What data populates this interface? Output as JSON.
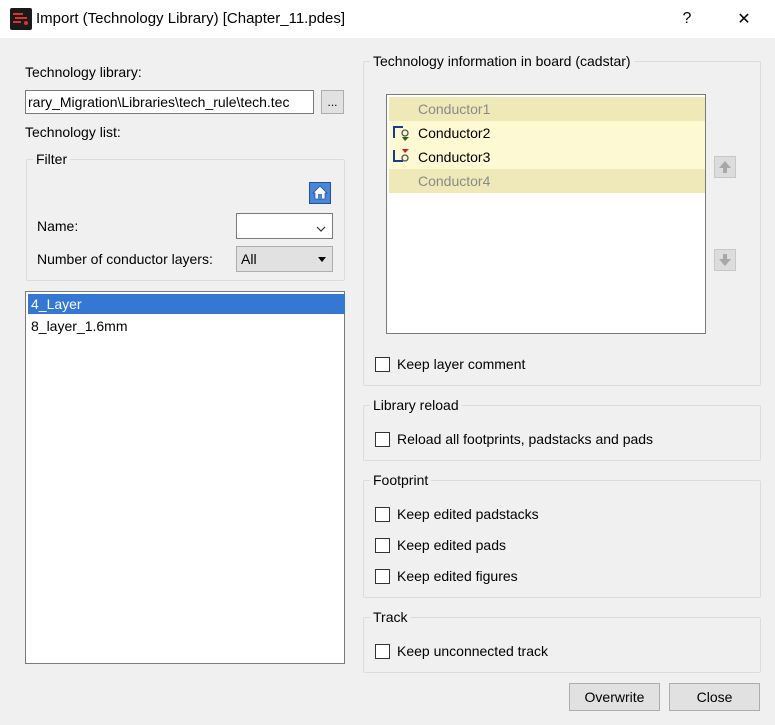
{
  "window": {
    "title": "Import (Technology Library) [Chapter_11.pdes]",
    "help_label": "?",
    "close_label": "✕"
  },
  "left": {
    "tech_library_label": "Technology library:",
    "tech_library_value": "rary_Migration\\Libraries\\tech_rule\\tech.tec",
    "browse_label": "...",
    "tech_list_label": "Technology list:",
    "filter": {
      "legend": "Filter",
      "name_label": "Name:",
      "name_value": "",
      "layers_label": "Number of conductor layers:",
      "layers_value": "All"
    },
    "list": {
      "items": [
        "4_Layer",
        "8_layer_1.6mm"
      ],
      "selected_index": 0
    }
  },
  "right": {
    "tech_info": {
      "legend": "Technology information in board (cadstar)",
      "conductors": [
        {
          "label": "Conductor1",
          "enabled": false
        },
        {
          "label": "Conductor2",
          "enabled": true
        },
        {
          "label": "Conductor3",
          "enabled": true
        },
        {
          "label": "Conductor4",
          "enabled": false
        }
      ],
      "keep_layer_comment": {
        "label": "Keep layer comment",
        "checked": false
      }
    },
    "library_reload": {
      "legend": "Library reload",
      "reload_all": {
        "label": "Reload all footprints, padstacks and pads",
        "checked": false
      }
    },
    "footprint": {
      "legend": "Footprint",
      "keep_padstacks": {
        "label": "Keep edited padstacks",
        "checked": false
      },
      "keep_pads": {
        "label": "Keep edited pads",
        "checked": false
      },
      "keep_figures": {
        "label": "Keep edited figures",
        "checked": false
      }
    },
    "track": {
      "legend": "Track",
      "keep_unconnected": {
        "label": "Keep unconnected track",
        "checked": false
      }
    }
  },
  "buttons": {
    "overwrite": "Overwrite",
    "close": "Close"
  },
  "colors": {
    "selection": "#3478d4",
    "conductor_bg": "#fdf9d2",
    "conductor_disabled_bg": "#efe9b8",
    "disabled_text": "#8a8a8a"
  }
}
